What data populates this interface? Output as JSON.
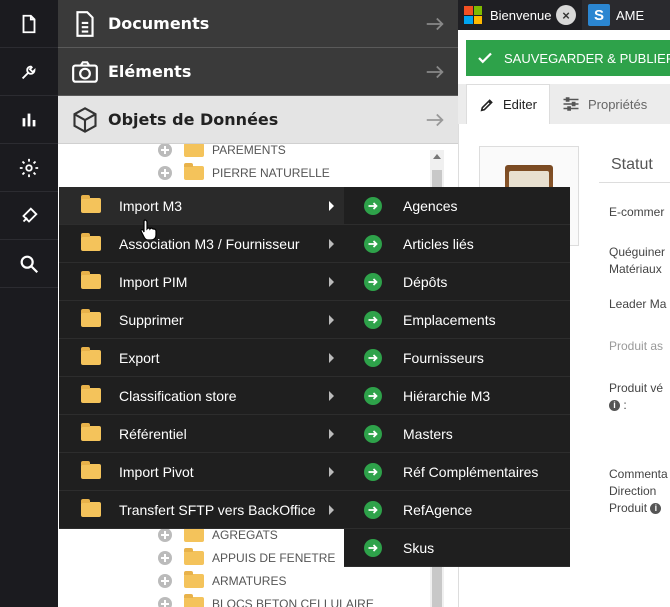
{
  "sidebar_sections": [
    {
      "label": "Documents",
      "icon": "document-icon"
    },
    {
      "label": "Eléments",
      "icon": "camera-icon"
    },
    {
      "label": "Objets de Données",
      "icon": "cube-icon"
    }
  ],
  "tree_items_top": [
    "PAREMENTS",
    "PIERRE NATURELLE"
  ],
  "tree_items_bottom": [
    "AGREGATS",
    "APPUIS DE FENETRE",
    "ARMATURES",
    "BLOCS BETON CELLULAIRE"
  ],
  "context_menu": [
    {
      "label": "Import M3",
      "active": true
    },
    {
      "label": "Association M3 / Fournisseur"
    },
    {
      "label": "Import PIM"
    },
    {
      "label": "Supprimer"
    },
    {
      "label": "Export"
    },
    {
      "label": "Classification store"
    },
    {
      "label": "Référentiel"
    },
    {
      "label": "Import Pivot"
    },
    {
      "label": "Transfert SFTP vers BackOffice"
    }
  ],
  "submenu": [
    "Agences",
    "Articles liés",
    "Dépôts",
    "Emplacements",
    "Fournisseurs",
    "Hiérarchie M3",
    "Masters",
    "Réf Complémentaires",
    "RefAgence",
    "Skus"
  ],
  "tabs": {
    "tab1": "Bienvenue",
    "tab2": "AME"
  },
  "save_label": "SAUVEGARDER & PUBLIER",
  "subtabs": {
    "edit": "Editer",
    "props": "Propriétés"
  },
  "statut": "Statut",
  "fields": {
    "f1": "E-commer",
    "f2a": "Quéguiner",
    "f2b": "Matériaux",
    "f3": "Leader Ma",
    "f4": "Produit as",
    "f5": "Produit vé",
    "f5b": ":",
    "f6a": "Commenta",
    "f6b": "Direction",
    "f6c": "Produit"
  },
  "colors": {
    "green": "#2ea24a",
    "folder": "#f4c35b",
    "dark": "#1f1f1f"
  }
}
